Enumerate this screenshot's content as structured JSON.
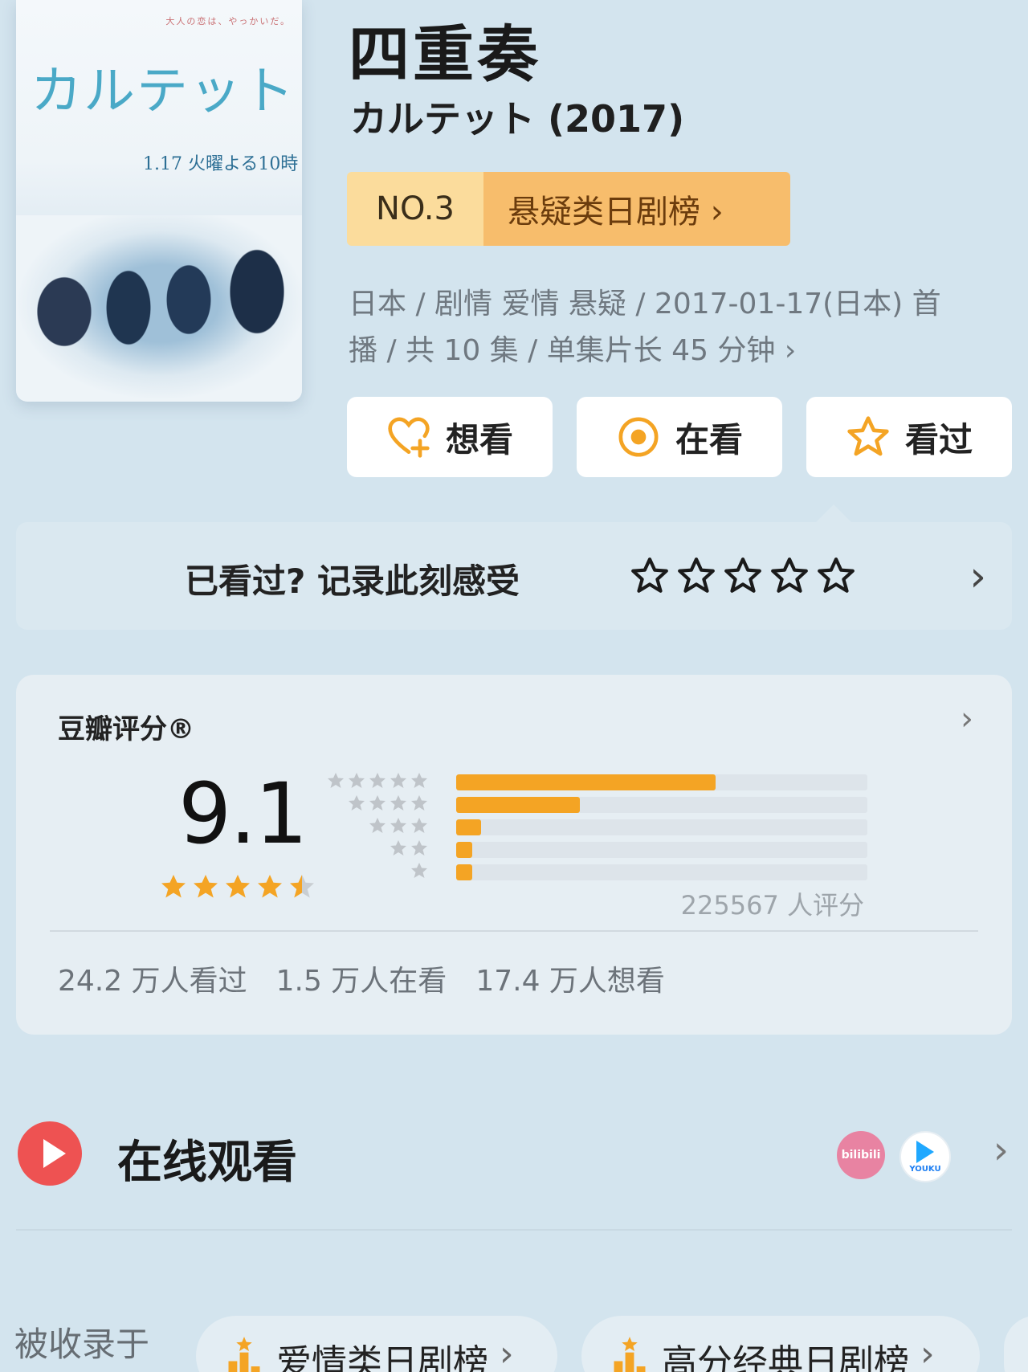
{
  "poster": {
    "tagline": "大人の恋は、やっかいだ。",
    "logo_text": "カルテット",
    "airdate": "1.17 火曜よる10時"
  },
  "title": "四重奏",
  "subtitle": "カルテット (2017)",
  "rank": {
    "number": "NO.3",
    "list_name": "悬疑类日剧榜 ›"
  },
  "meta": {
    "line1": "日本 / 剧情 爱情 悬疑 / 2017-01-17(日本) 首",
    "line2": "播 / 共 10 集 / 单集片长 45 分钟 ›"
  },
  "actions": [
    {
      "label": "想看",
      "icon": "heart-plus-icon"
    },
    {
      "label": "在看",
      "icon": "target-icon"
    },
    {
      "label": "看过",
      "icon": "star-icon"
    }
  ],
  "record": {
    "prompt": "已看过? 记录此刻感受",
    "star_count": 5
  },
  "rating": {
    "label": "豆瓣评分®",
    "score": "9.1",
    "score_stars": 4.5,
    "rater_count": "225567 人评分",
    "distribution": [
      {
        "stars": 5,
        "fraction": 0.63
      },
      {
        "stars": 4,
        "fraction": 0.3
      },
      {
        "stars": 3,
        "fraction": 0.06
      },
      {
        "stars": 2,
        "fraction": 0.04
      },
      {
        "stars": 1,
        "fraction": 0.04
      }
    ],
    "stats": {
      "watched": "24.2 万人看过",
      "watching": "1.5 万人在看",
      "want": "17.4 万人想看"
    }
  },
  "online": {
    "label": "在线观看",
    "platforms": [
      "bilibili",
      "YOUKU"
    ]
  },
  "collected": {
    "label": "被收录于",
    "lists": [
      "爱情类日剧榜",
      "高分经典日剧榜"
    ]
  },
  "colors": {
    "background": "#d3e4ee",
    "accent_orange": "#f4a424",
    "rank_number_bg": "#fbdc9c",
    "rank_name_bg": "#f7bd6c",
    "play_red": "#ee5252"
  }
}
